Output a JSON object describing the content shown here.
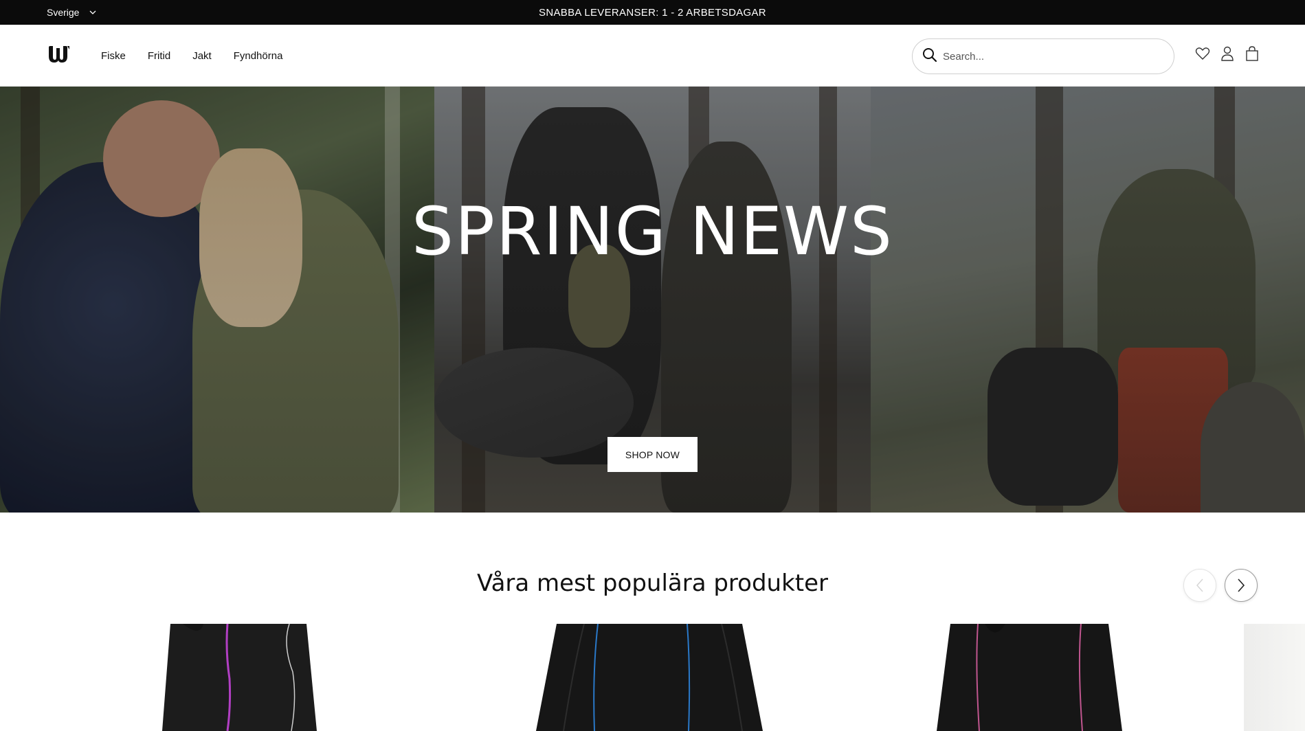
{
  "topbar": {
    "country": "Sverige",
    "announcement": "SNABBA LEVERANSER: 1 - 2 ARBETSDAGAR"
  },
  "header": {
    "nav": [
      "Fiske",
      "Fritid",
      "Jakt",
      "Fyndhörna"
    ],
    "search_placeholder": "Search...",
    "icons": [
      "heart-icon",
      "user-icon",
      "bag-icon"
    ]
  },
  "hero": {
    "title": "SPRING NEWS",
    "cta": "SHOP NOW"
  },
  "popular": {
    "title": "Våra mest populära produkter",
    "accent_colors": [
      "#b23fc4",
      "#2a79c9",
      "#c0568f"
    ]
  }
}
